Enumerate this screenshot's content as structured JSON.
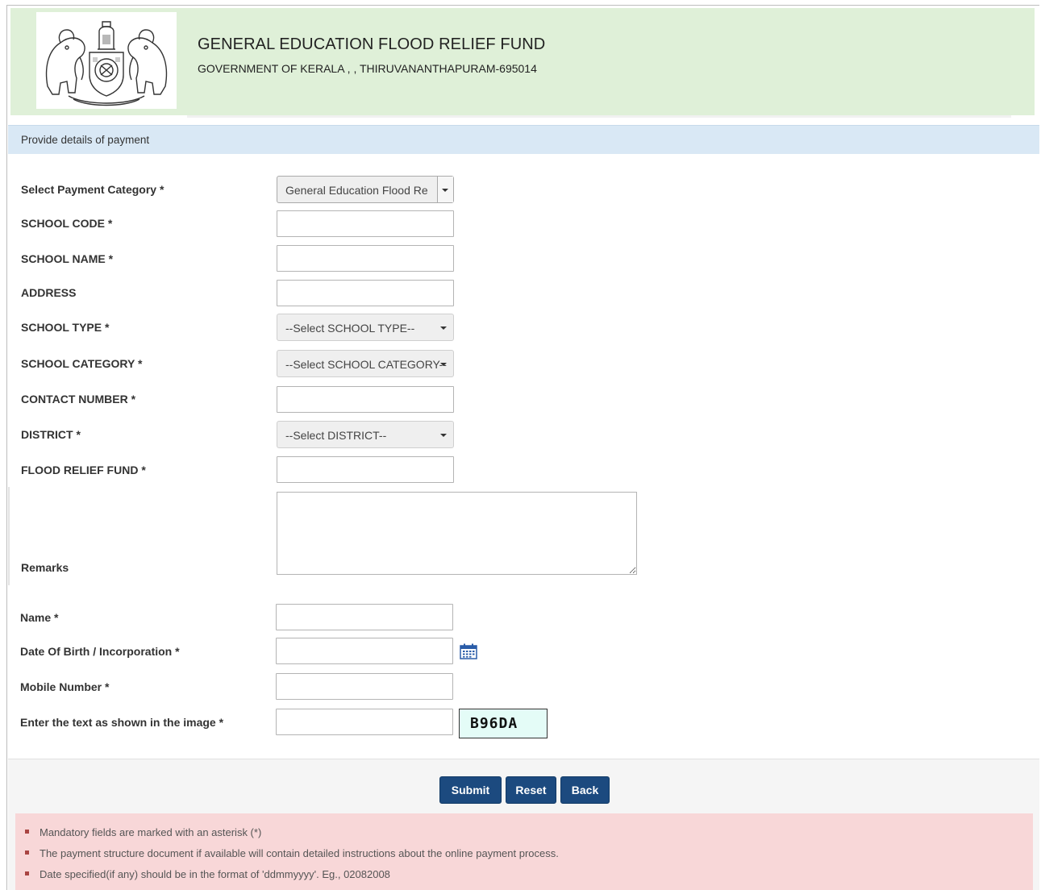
{
  "header": {
    "title": "GENERAL EDUCATION FLOOD RELIEF FUND",
    "subtitle": "GOVERNMENT OF KERALA , , THIRUVANANTHAPURAM-695014"
  },
  "section": {
    "title": "Provide details of payment"
  },
  "form": {
    "payment_category": {
      "label": "Select Payment Category *",
      "value": "General Education Flood Re"
    },
    "school_code": {
      "label": "SCHOOL CODE *",
      "value": ""
    },
    "school_name": {
      "label": "SCHOOL NAME *",
      "value": ""
    },
    "address": {
      "label": "ADDRESS",
      "value": ""
    },
    "school_type": {
      "label": "SCHOOL TYPE *",
      "value": "--Select SCHOOL TYPE--"
    },
    "school_category": {
      "label": "SCHOOL CATEGORY *",
      "value": "--Select SCHOOL CATEGORY--"
    },
    "contact_number": {
      "label": "CONTACT NUMBER *",
      "value": ""
    },
    "district": {
      "label": "DISTRICT *",
      "value": "--Select DISTRICT--"
    },
    "flood_relief_fund": {
      "label": "FLOOD RELIEF FUND *",
      "value": ""
    },
    "remarks": {
      "label": "Remarks",
      "value": ""
    },
    "name": {
      "label": "Name *",
      "value": ""
    },
    "dob": {
      "label": "Date Of Birth / Incorporation *",
      "value": ""
    },
    "mobile": {
      "label": "Mobile Number *",
      "value": ""
    },
    "captcha": {
      "label": "Enter the text as shown in the image *",
      "value": "",
      "image_text": "B96DA"
    }
  },
  "buttons": {
    "submit": "Submit",
    "reset": "Reset",
    "back": "Back"
  },
  "notes": [
    "Mandatory fields are marked with an asterisk (*)",
    "The payment structure document if available will contain detailed instructions about the online payment process.",
    "Date specified(if any) should be in the format of 'ddmmyyyy'. Eg., 02082008"
  ],
  "icons": {
    "emblem": "kerala-emblem-icon",
    "calendar": "calendar-icon"
  },
  "colors": {
    "header_bg": "#dff0d8",
    "section_bg": "#d9e8f5",
    "button_bg": "#1c4a7f",
    "notes_bg": "#f8d7d8"
  }
}
